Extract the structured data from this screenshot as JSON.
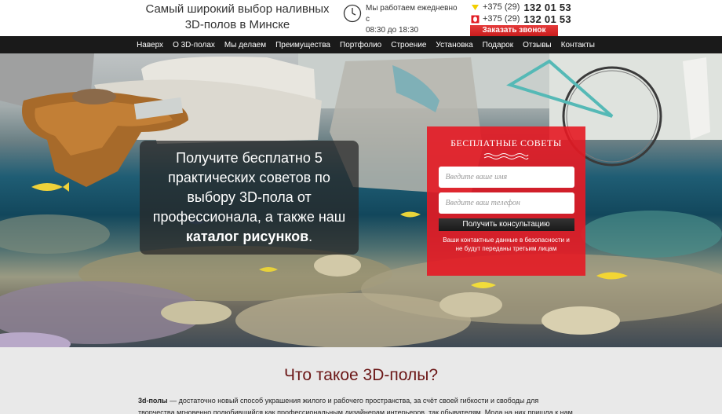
{
  "header": {
    "title_line1": "Самый широкий выбор наливных",
    "title_line2": "3D-полов в Минске",
    "hours_line1": "Мы работаем ежедневно с",
    "hours_line2": "08:30 до 18:30",
    "phones": [
      {
        "operator_icon": "velcom-icon",
        "code": "+375 (29)",
        "number": "132 01 53",
        "color": "#f2cf00"
      },
      {
        "operator_icon": "mts-icon",
        "code": "+375 (29)",
        "number": "132 01 53",
        "color": "#e11b22"
      }
    ],
    "callback_label": "Заказать звонок"
  },
  "nav": {
    "items": [
      "Наверх",
      "О 3D-полах",
      "Мы делаем",
      "Преимущества",
      "Портфолио",
      "Строение",
      "Установка",
      "Подарок",
      "Отзывы",
      "Контакты"
    ]
  },
  "hero": {
    "text_line1": "Получите бесплатно 5",
    "text_line2": "практических советов по",
    "text_line3": "выбору 3D-пола от",
    "text_line4": "профессионала, а также наш",
    "text_bold": "каталог рисунков",
    "text_end": "."
  },
  "form": {
    "title": "БЕСПЛАТНЫЕ СОВЕТЫ",
    "name_placeholder": "Введите ваше имя",
    "phone_placeholder": "Введите ваш телефон",
    "submit_label": "Получить консультацию",
    "note_line1": "Ваши контактные данные в безопасности и",
    "note_line2": "не будут переданы третьим лицам"
  },
  "section": {
    "title": "Что такое 3D-полы?",
    "lead_bold": "3d-полы",
    "text_line1": " — достаточно новый способ украшения жилого и рабочего пространства, за счёт своей гибкости и свободы для",
    "text_line2": "творчества мгновенно полюбившийся как профессиональным дизайнерам интерьеров, так обывателям. Мода на них пришла к нам"
  },
  "colors": {
    "accent_red": "#e61923",
    "title_dark_red": "#6b1616",
    "nav_bg": "#1a1a1a"
  }
}
